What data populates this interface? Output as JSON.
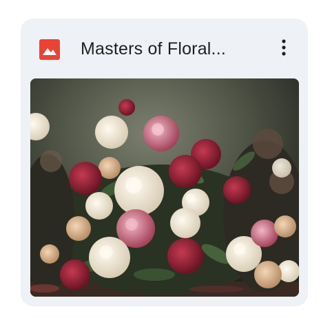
{
  "file": {
    "title": "Masters of Floral...",
    "icon": "image-file-icon",
    "icon_color": "#ea4335"
  },
  "actions": {
    "more_icon": "more-vertical-icon"
  },
  "colors": {
    "card_background": "#eef1f6",
    "text": "#1f1f1f"
  }
}
